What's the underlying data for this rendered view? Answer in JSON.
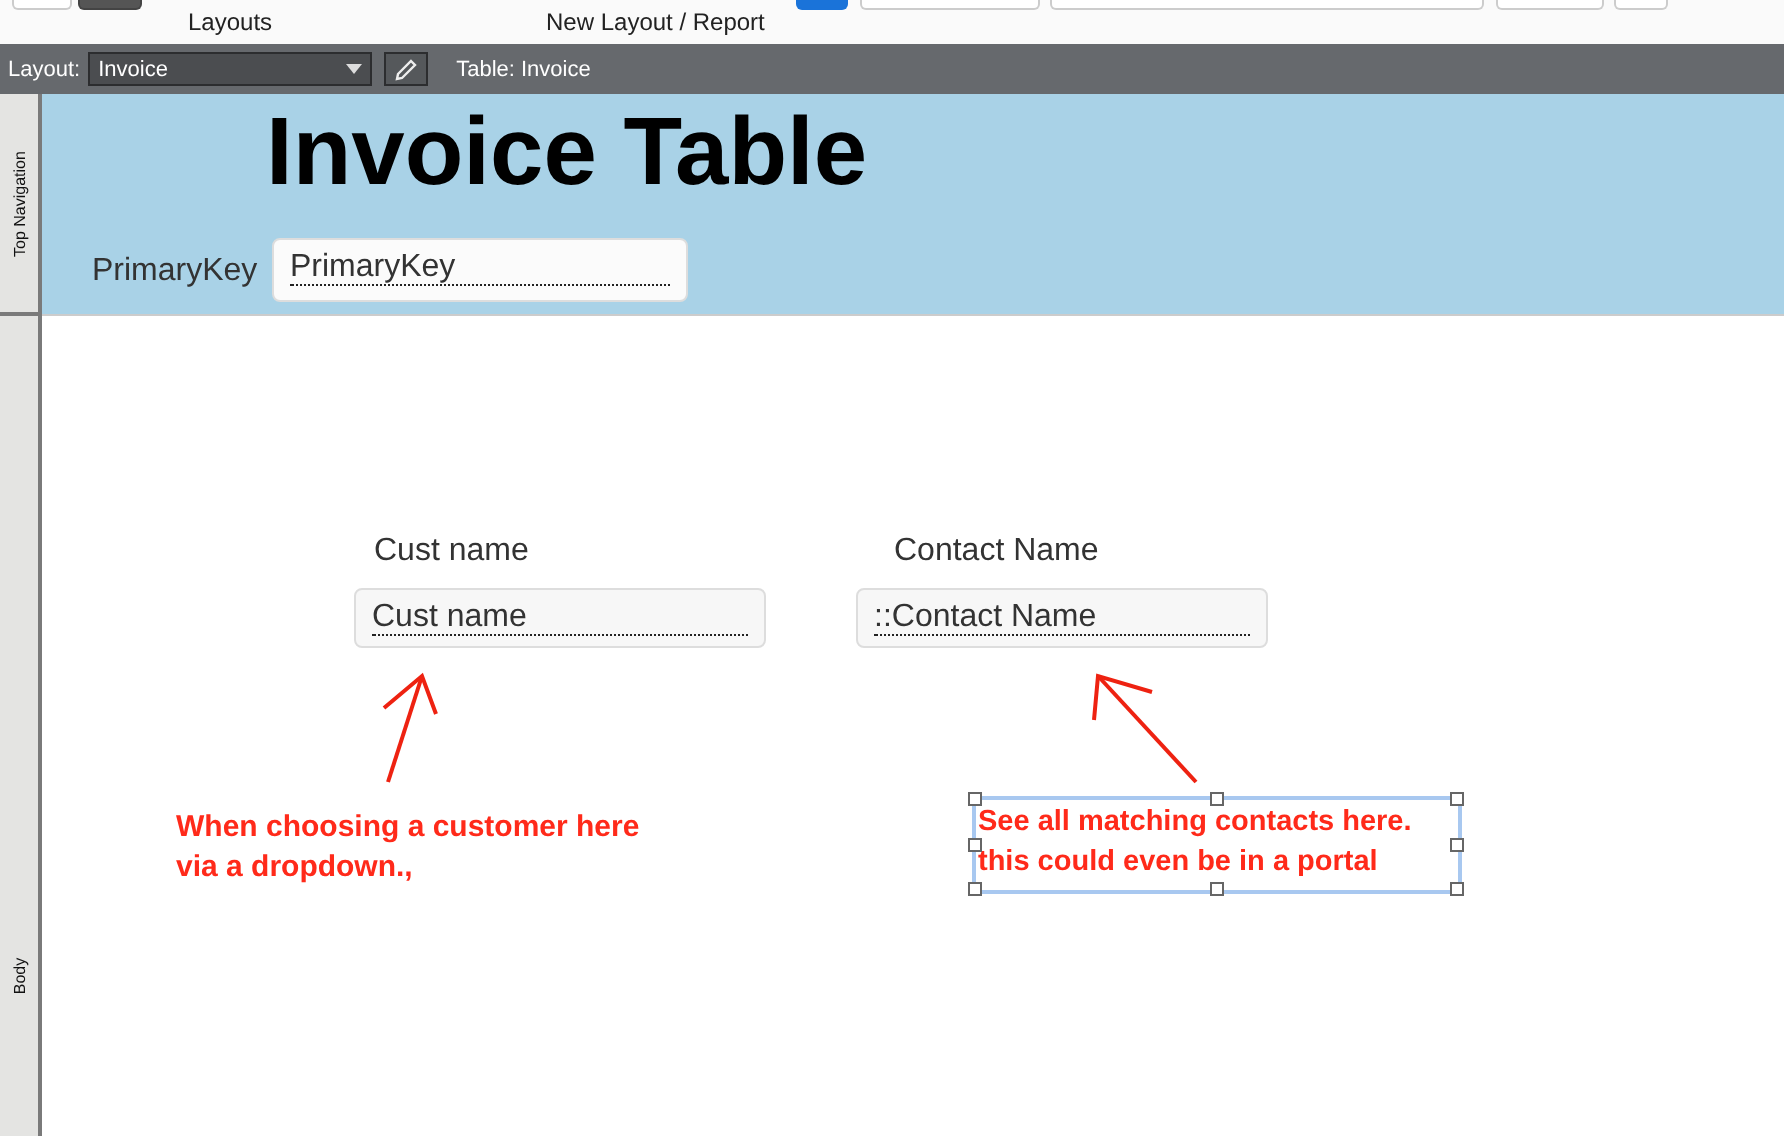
{
  "toolbar": {
    "labels": [
      "Layouts",
      "New Layout / Report"
    ]
  },
  "layout_bar": {
    "layout_label": "Layout:",
    "layout_value": "Invoice",
    "table_label": "Table: Invoice"
  },
  "parts": [
    {
      "name": "Top Navigation"
    },
    {
      "name": "Body"
    }
  ],
  "header": {
    "title": "Invoice Table",
    "field_label": "PrimaryKey",
    "field_value": "PrimaryKey"
  },
  "fields": [
    {
      "label": "Cust name",
      "value": "Cust name"
    },
    {
      "label": "Contact Name",
      "value": "::Contact Name"
    }
  ],
  "notes": [
    {
      "lines": [
        "When choosing a customer here",
        "via a dropdown.,"
      ],
      "selected": false
    },
    {
      "lines": [
        "See all matching contacts here.",
        "this could even be in a portal"
      ],
      "selected": true
    }
  ]
}
